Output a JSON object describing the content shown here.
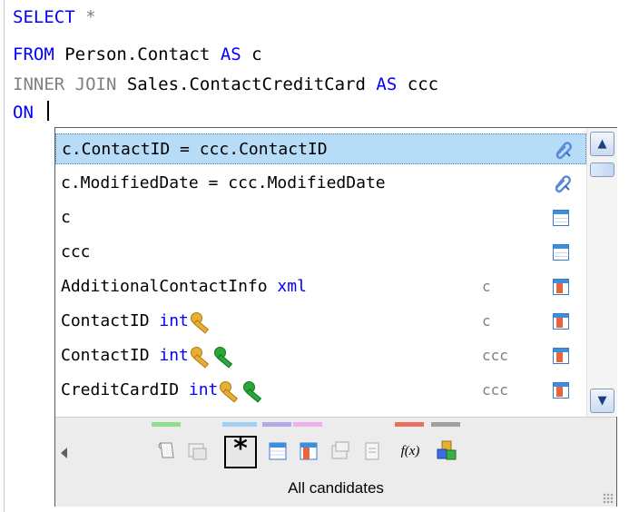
{
  "editor": {
    "line1": {
      "kw": "SELECT",
      "sym": "*"
    },
    "line2": {
      "kw": "FROM",
      "text1": "Person.Contact",
      "kw2": "AS",
      "text2": "c"
    },
    "line3": {
      "kw": "INNER JOIN",
      "text1": "Sales.ContactCreditCard",
      "kw2": "AS",
      "text2": "ccc"
    },
    "line4": {
      "kw": "ON"
    }
  },
  "completion": {
    "items": [
      {
        "text": "c.ContactID = ccc.ContactID",
        "type": "",
        "table": "",
        "icon": "join-icon",
        "selected": true
      },
      {
        "text": "c.ModifiedDate = ccc.ModifiedDate",
        "type": "",
        "table": "",
        "icon": "join-icon"
      },
      {
        "text": "c",
        "type": "",
        "table": "",
        "icon": "table-icon"
      },
      {
        "text": "ccc",
        "type": "",
        "table": "",
        "icon": "table-icon"
      },
      {
        "text": "AdditionalContactInfo",
        "type": "xml",
        "table": "c",
        "icon": "column-icon"
      },
      {
        "text": "ContactID",
        "type": "int",
        "table": "c",
        "icon": "column-icon",
        "keys": [
          "primary-key"
        ]
      },
      {
        "text": "ContactID",
        "type": "int",
        "table": "ccc",
        "icon": "column-icon",
        "keys": [
          "primary-key",
          "foreign-key"
        ]
      },
      {
        "text": "CreditCardID",
        "type": "int",
        "table": "ccc",
        "icon": "column-icon",
        "keys": [
          "primary-key",
          "foreign-key"
        ]
      }
    ],
    "filters": [
      {
        "name": "snippet-filter-icon",
        "bar": "#8ce08c"
      },
      {
        "name": "view-filter-icon",
        "bar": ""
      },
      {
        "name": "all-candidates-icon",
        "bar": "#a0d0f0",
        "active": true
      },
      {
        "name": "table-filter-icon",
        "bar": "#b8a8e8"
      },
      {
        "name": "column-filter-icon",
        "bar": "#f0b0f0"
      },
      {
        "name": "procedure-filter-icon",
        "bar": ""
      },
      {
        "name": "keyword-filter-icon",
        "bar": ""
      },
      {
        "name": "function-filter-icon",
        "bar": "#e87060"
      },
      {
        "name": "object-filter-icon",
        "bar": "#a0a0a0"
      }
    ],
    "status": "All candidates",
    "fx_label": "f(x)"
  }
}
